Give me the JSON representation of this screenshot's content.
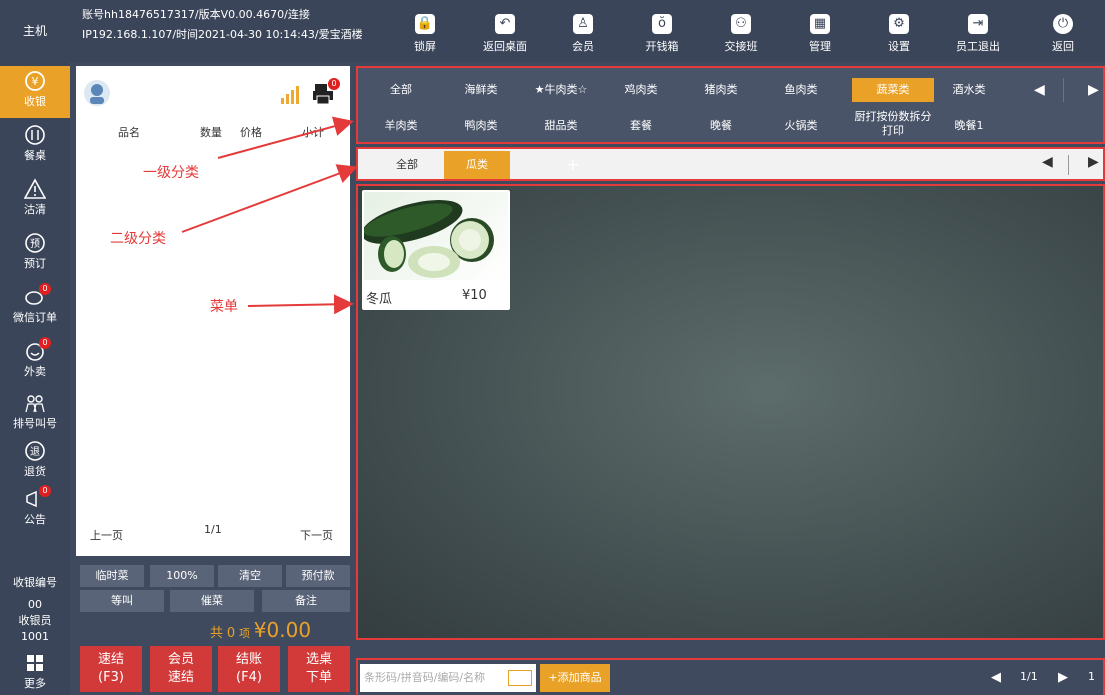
{
  "sidebar": {
    "main_label": "主机",
    "items": [
      {
        "label": "收银",
        "icon": "cashier-yen-icon",
        "active": true
      },
      {
        "label": "餐桌",
        "icon": "dining-icon"
      },
      {
        "label": "沽清",
        "icon": "warning-icon"
      },
      {
        "label": "预订",
        "icon": "reserve-icon"
      },
      {
        "label": "微信订单",
        "icon": "wechat-order-icon",
        "badge": "0"
      },
      {
        "label": "外卖",
        "icon": "takeout-icon",
        "badge": "0"
      },
      {
        "label": "排号叫号",
        "icon": "queue-icon"
      },
      {
        "label": "退货",
        "icon": "return-icon"
      },
      {
        "label": "公告",
        "icon": "notice-icon",
        "badge": "0"
      }
    ],
    "cashier_no_label": "收银编号",
    "cashier_no": "00",
    "cashier_label": "收银员",
    "cashier_id": "1001",
    "more_label": "更多"
  },
  "header": {
    "account_line": "账号hh18476517317/版本V0.00.4670/连接",
    "ip_line": "IP192.168.1.107/时间2021-04-30 10:14:43/爱宝酒楼",
    "buttons": [
      {
        "label": "锁屏",
        "icon": "lock-icon"
      },
      {
        "label": "返回桌面",
        "icon": "back-arrow-icon"
      },
      {
        "label": "会员",
        "icon": "member-icon"
      },
      {
        "label": "开钱箱",
        "icon": "cash-drawer-icon"
      },
      {
        "label": "交接班",
        "icon": "shift-icon"
      },
      {
        "label": "管理",
        "icon": "manage-icon"
      },
      {
        "label": "设置",
        "icon": "gear-icon"
      },
      {
        "label": "员工退出",
        "icon": "logout-icon"
      },
      {
        "label": "返回",
        "icon": "power-icon"
      }
    ]
  },
  "order": {
    "printer_badge": "0",
    "col_name": "品名",
    "col_qty": "数量",
    "col_price": "价格",
    "col_subtotal": "小计",
    "prev": "上一页",
    "page": "1/1",
    "next": "下一页"
  },
  "actions": {
    "row1": [
      "临时菜",
      "100%",
      "清空",
      "预付款"
    ],
    "row2": [
      "等叫",
      "催菜",
      "备注"
    ],
    "total_prefix": "共",
    "total_count": "0",
    "total_unit": "项",
    "total_amount": "¥0.00",
    "big": [
      "速结\n(F3)",
      "会员\n速结",
      "结账\n(F4)",
      "选桌\n下单"
    ]
  },
  "cat1": {
    "row1": [
      "全部",
      "海鲜类",
      "★牛肉类☆",
      "鸡肉类",
      "猪肉类",
      "鱼肉类",
      "蔬菜类",
      "酒水类"
    ],
    "row2": [
      "羊肉类",
      "鸭肉类",
      "甜品类",
      "套餐",
      "晚餐",
      "火锅类",
      "厨打按份数拆分打印",
      "晚餐1"
    ],
    "active": "蔬菜类"
  },
  "cat2": {
    "items": [
      "全部",
      "瓜类"
    ],
    "active": "瓜类",
    "add": "+"
  },
  "menu": {
    "dishes": [
      {
        "name": "冬瓜",
        "price": "¥10"
      }
    ]
  },
  "bottom": {
    "search_placeholder": "条形码/拼音码/编码/名称",
    "add_button": "+添加商品",
    "page": "1/1",
    "extra": "1"
  },
  "annotations": {
    "cat1": "一级分类",
    "cat2": "二级分类",
    "menu": "菜单"
  }
}
